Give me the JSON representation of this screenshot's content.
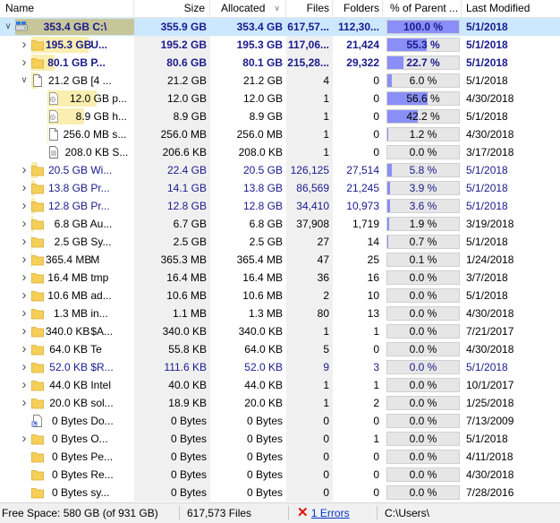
{
  "headers": {
    "name": "Name",
    "size": "Size",
    "allocated": "Allocated",
    "files": "Files",
    "folders": "Folders",
    "percent": "% of Parent ...",
    "modified": "Last Modified"
  },
  "rows": [
    {
      "indent": 0,
      "expand": "down",
      "icon": "drive",
      "selected": true,
      "bold": true,
      "blue": false,
      "name_size": "353.4 GB",
      "name": "C:\\",
      "size": "355.9 GB",
      "allocated": "353.4 GB",
      "files": "617,57...",
      "folders": "112,30...",
      "pct": "100.0 %",
      "pct_value": 1.0,
      "modified": "5/1/2018",
      "bar": 1.0
    },
    {
      "indent": 1,
      "expand": "right",
      "icon": "folder",
      "bold": true,
      "blue": true,
      "name_size": "195.3 GB",
      "name": "U...",
      "size": "195.2 GB",
      "allocated": "195.3 GB",
      "files": "117,06...",
      "folders": "21,424",
      "pct": "55.3 %",
      "pct_value": 0.553,
      "modified": "5/1/2018",
      "bar": 0.553
    },
    {
      "indent": 1,
      "expand": "right",
      "icon": "folder",
      "bold": true,
      "blue": true,
      "name_size": "80.1 GB",
      "name": "P...",
      "size": "80.6 GB",
      "allocated": "80.1 GB",
      "files": "215,28...",
      "folders": "29,322",
      "pct": "22.7 %",
      "pct_value": 0.227,
      "modified": "5/1/2018",
      "bar": 0.227
    },
    {
      "indent": 1,
      "expand": "down",
      "icon": "file",
      "name_size": "21.2 GB",
      "name": "[4 ...",
      "size": "21.2 GB",
      "allocated": "21.2 GB",
      "files": "4",
      "folders": "0",
      "pct": "6.0 %",
      "pct_value": 0.06,
      "modified": "5/1/2018",
      "bar": 0.06
    },
    {
      "indent": 2,
      "expand": "",
      "icon": "sysfile",
      "name_size": "12.0 GB",
      "name": "p...",
      "size": "12.0 GB",
      "allocated": "12.0 GB",
      "files": "1",
      "folders": "0",
      "pct": "56.6 %",
      "pct_value": 0.566,
      "modified": "4/30/2018",
      "bar": 0.566
    },
    {
      "indent": 2,
      "expand": "",
      "icon": "sysfile",
      "name_size": "8.9 GB",
      "name": "h...",
      "size": "8.9 GB",
      "allocated": "8.9 GB",
      "files": "1",
      "folders": "0",
      "pct": "42.2 %",
      "pct_value": 0.422,
      "modified": "5/1/2018",
      "bar": 0.422
    },
    {
      "indent": 2,
      "expand": "",
      "icon": "file",
      "name_size": "256.0 MB",
      "name": "s...",
      "size": "256.0 MB",
      "allocated": "256.0 MB",
      "files": "1",
      "folders": "0",
      "pct": "1.2 %",
      "pct_value": 0.012,
      "modified": "4/30/2018",
      "bar": 0.012
    },
    {
      "indent": 2,
      "expand": "",
      "icon": "textfile",
      "name_size": "208.0 KB",
      "name": "S...",
      "size": "206.6 KB",
      "allocated": "208.0 KB",
      "files": "1",
      "folders": "0",
      "pct": "0.0 %",
      "pct_value": 0.0,
      "modified": "3/17/2018",
      "bar": 0.0
    },
    {
      "indent": 1,
      "expand": "right",
      "icon": "folder",
      "blue": true,
      "name_size": "20.5 GB",
      "name": "Wi...",
      "size": "22.4 GB",
      "allocated": "20.5 GB",
      "files": "126,125",
      "folders": "27,514",
      "pct": "5.8 %",
      "pct_value": 0.058,
      "modified": "5/1/2018",
      "bar": 0.058
    },
    {
      "indent": 1,
      "expand": "right",
      "icon": "folder",
      "blue": true,
      "name_size": "13.8 GB",
      "name": "Pr...",
      "size": "14.1 GB",
      "allocated": "13.8 GB",
      "files": "86,569",
      "folders": "21,245",
      "pct": "3.9 %",
      "pct_value": 0.039,
      "modified": "5/1/2018",
      "bar": 0.039
    },
    {
      "indent": 1,
      "expand": "right",
      "icon": "folder",
      "blue": true,
      "name_size": "12.8 GB",
      "name": "Pr...",
      "size": "12.8 GB",
      "allocated": "12.8 GB",
      "files": "34,410",
      "folders": "10,973",
      "pct": "3.6 %",
      "pct_value": 0.036,
      "modified": "5/1/2018",
      "bar": 0.036
    },
    {
      "indent": 1,
      "expand": "right",
      "icon": "folder",
      "name_size": "6.8 GB",
      "name": "Au...",
      "size": "6.7 GB",
      "allocated": "6.8 GB",
      "files": "37,908",
      "folders": "1,719",
      "pct": "1.9 %",
      "pct_value": 0.019,
      "modified": "3/19/2018",
      "bar": 0.019
    },
    {
      "indent": 1,
      "expand": "right",
      "icon": "folder",
      "name_size": "2.5 GB",
      "name": "Sy...",
      "size": "2.5 GB",
      "allocated": "2.5 GB",
      "files": "27",
      "folders": "14",
      "pct": "0.7 %",
      "pct_value": 0.007,
      "modified": "5/1/2018",
      "bar": 0.007
    },
    {
      "indent": 1,
      "expand": "right",
      "icon": "folder",
      "name_size": "365.4 MB",
      "name": "M",
      "size": "365.3 MB",
      "allocated": "365.4 MB",
      "files": "47",
      "folders": "25",
      "pct": "0.1 %",
      "pct_value": 0.001,
      "modified": "1/24/2018",
      "bar": 0.001
    },
    {
      "indent": 1,
      "expand": "right",
      "icon": "folder",
      "name_size": "16.4 MB",
      "name": "tmp",
      "size": "16.4 MB",
      "allocated": "16.4 MB",
      "files": "36",
      "folders": "16",
      "pct": "0.0 %",
      "pct_value": 0.0,
      "modified": "3/7/2018",
      "bar": 0.0
    },
    {
      "indent": 1,
      "expand": "right",
      "icon": "folder",
      "name_size": "10.6 MB",
      "name": "ad...",
      "size": "10.6 MB",
      "allocated": "10.6 MB",
      "files": "2",
      "folders": "10",
      "pct": "0.0 %",
      "pct_value": 0.0,
      "modified": "5/1/2018",
      "bar": 0.0
    },
    {
      "indent": 1,
      "expand": "right",
      "icon": "folder",
      "name_size": "1.3 MB",
      "name": "in...",
      "size": "1.1 MB",
      "allocated": "1.3 MB",
      "files": "80",
      "folders": "13",
      "pct": "0.0 %",
      "pct_value": 0.0,
      "modified": "4/30/2018",
      "bar": 0.0
    },
    {
      "indent": 1,
      "expand": "right",
      "icon": "folder",
      "name_size": "340.0 KB",
      "name": "$A...",
      "size": "340.0 KB",
      "allocated": "340.0 KB",
      "files": "1",
      "folders": "1",
      "pct": "0.0 %",
      "pct_value": 0.0,
      "modified": "7/21/2017",
      "bar": 0.0
    },
    {
      "indent": 1,
      "expand": "right",
      "icon": "folder",
      "name_size": "64.0 KB",
      "name": "Te",
      "size": "55.8 KB",
      "allocated": "64.0 KB",
      "files": "5",
      "folders": "0",
      "pct": "0.0 %",
      "pct_value": 0.0,
      "modified": "4/30/2018",
      "bar": 0.0
    },
    {
      "indent": 1,
      "expand": "right",
      "icon": "folder",
      "blue": true,
      "name_size": "52.0 KB",
      "name": "$R...",
      "size": "111.6 KB",
      "allocated": "52.0 KB",
      "files": "9",
      "folders": "3",
      "pct": "0.0 %",
      "pct_value": 0.0,
      "modified": "5/1/2018",
      "bar": 0.0
    },
    {
      "indent": 1,
      "expand": "right",
      "icon": "folder",
      "name_size": "44.0 KB",
      "name": "Intel",
      "size": "40.0 KB",
      "allocated": "44.0 KB",
      "files": "1",
      "folders": "1",
      "pct": "0.0 %",
      "pct_value": 0.0,
      "modified": "10/1/2017",
      "bar": 0.0
    },
    {
      "indent": 1,
      "expand": "right",
      "icon": "folder",
      "name_size": "20.0 KB",
      "name": "sol...",
      "size": "18.9 KB",
      "allocated": "20.0 KB",
      "files": "1",
      "folders": "2",
      "pct": "0.0 %",
      "pct_value": 0.0,
      "modified": "1/25/2018",
      "bar": 0.0
    },
    {
      "indent": 1,
      "expand": "",
      "icon": "shortcut",
      "name_size": "0 Bytes",
      "name": "Do...",
      "size": "0 Bytes",
      "allocated": "0 Bytes",
      "files": "0",
      "folders": "0",
      "pct": "0.0 %",
      "pct_value": 0.0,
      "modified": "7/13/2009",
      "bar": 0.0
    },
    {
      "indent": 1,
      "expand": "right",
      "icon": "folder",
      "name_size": "0 Bytes",
      "name": "O...",
      "size": "0 Bytes",
      "allocated": "0 Bytes",
      "files": "0",
      "folders": "1",
      "pct": "0.0 %",
      "pct_value": 0.0,
      "modified": "5/1/2018",
      "bar": 0.0
    },
    {
      "indent": 1,
      "expand": "",
      "icon": "folder",
      "name_size": "0 Bytes",
      "name": "Pe...",
      "size": "0 Bytes",
      "allocated": "0 Bytes",
      "files": "0",
      "folders": "0",
      "pct": "0.0 %",
      "pct_value": 0.0,
      "modified": "4/11/2018",
      "bar": 0.0
    },
    {
      "indent": 1,
      "expand": "",
      "icon": "folder",
      "name_size": "0 Bytes",
      "name": "Re...",
      "size": "0 Bytes",
      "allocated": "0 Bytes",
      "files": "0",
      "folders": "0",
      "pct": "0.0 %",
      "pct_value": 0.0,
      "modified": "4/30/2018",
      "bar": 0.0
    },
    {
      "indent": 1,
      "expand": "",
      "icon": "folder",
      "name_size": "0 Bytes",
      "name": "sy...",
      "size": "0 Bytes",
      "allocated": "0 Bytes",
      "files": "0",
      "folders": "0",
      "pct": "0.0 %",
      "pct_value": 0.0,
      "modified": "7/28/2016",
      "bar": 0.0
    }
  ],
  "status": {
    "free_space": "Free Space: 580 GB  (of 931 GB)",
    "files": "617,573  Files",
    "errors": "1 Errors",
    "path": "C:\\Users\\"
  },
  "colors": {
    "selection": "#cce8ff",
    "pct_fill": "#8a8ff7",
    "size_bar": "#faeeb0",
    "folder": "#f5cf5a",
    "bold_text": "#1a1a8c",
    "error": "#e01010"
  }
}
